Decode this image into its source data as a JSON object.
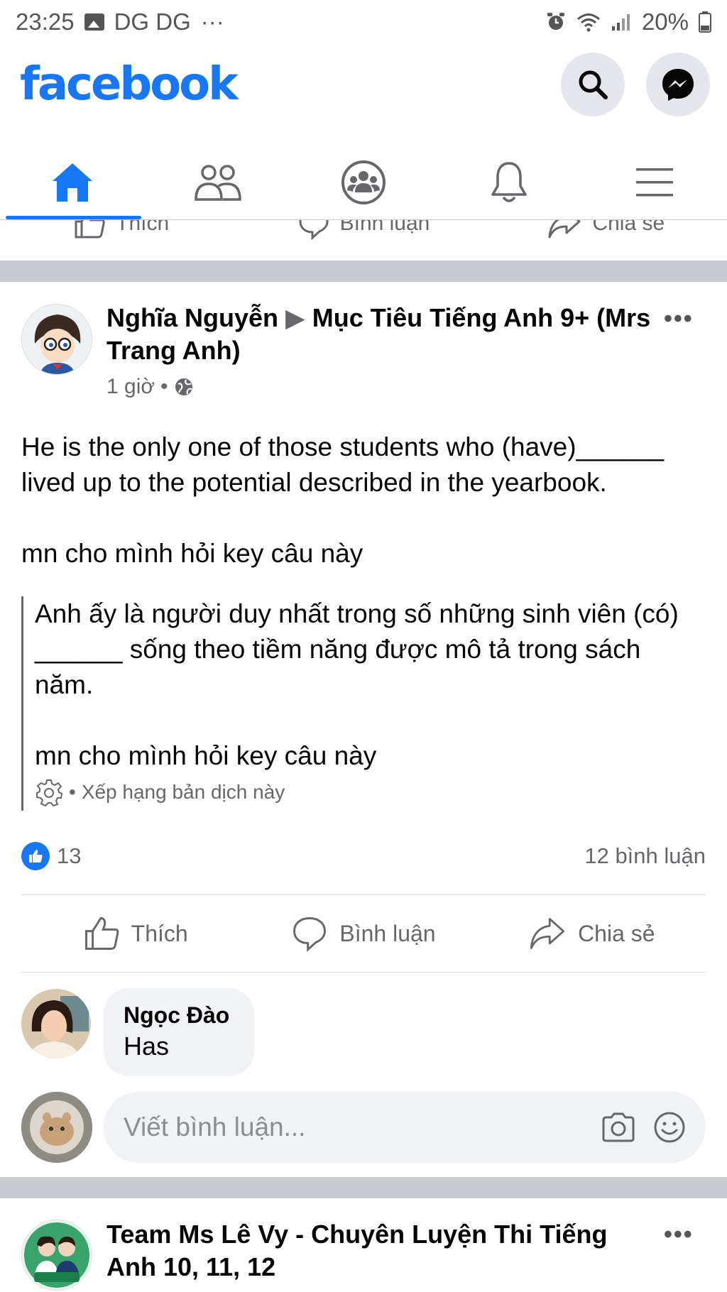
{
  "status_bar": {
    "time": "23:25",
    "carrier": "DG DG",
    "more": "···",
    "battery": "20%"
  },
  "header": {
    "logo": "facebook",
    "brand_color": "#1877f2",
    "icons": [
      "search-icon",
      "messenger-icon"
    ]
  },
  "nav": {
    "active_tab": "home",
    "tabs": [
      "home-icon",
      "friends-icon",
      "groups-icon",
      "notifications-icon",
      "menu-icon"
    ]
  },
  "previous_post_actions": {
    "like": "Thích",
    "comment": "Bình luận",
    "share": "Chia sẻ"
  },
  "post": {
    "author": "Nghĩa Nguyễn",
    "arrow": "▶",
    "group": "Mục Tiêu Tiếng Anh 9+ (Mrs Trang Anh)",
    "time": "1 giờ",
    "dot": "•",
    "more": "•••",
    "body": [
      "He is the only one of those students who (have)______ lived up to the potential described in the yearbook.",
      "mn cho mình hỏi key câu này"
    ],
    "translation": [
      "Anh ấy là người duy nhất trong số những sinh viên (có) ______ sống theo tiềm năng được mô tả trong sách năm.",
      "mn cho mình hỏi key câu này"
    ],
    "rate_translation": "Xếp hạng bản dịch này",
    "reaction_count": "13",
    "comment_count": "12 bình luận",
    "actions": {
      "like": "Thích",
      "comment": "Bình luận",
      "share": "Chia sẻ"
    }
  },
  "comment": {
    "author": "Ngọc Đào",
    "text": "Has"
  },
  "write_comment": {
    "placeholder": "Viết bình luận..."
  },
  "next_post": {
    "author": "Team Ms Lê Vy - Chuyên Luyện Thi Tiếng Anh 10, 11, 12",
    "more": "•••"
  }
}
